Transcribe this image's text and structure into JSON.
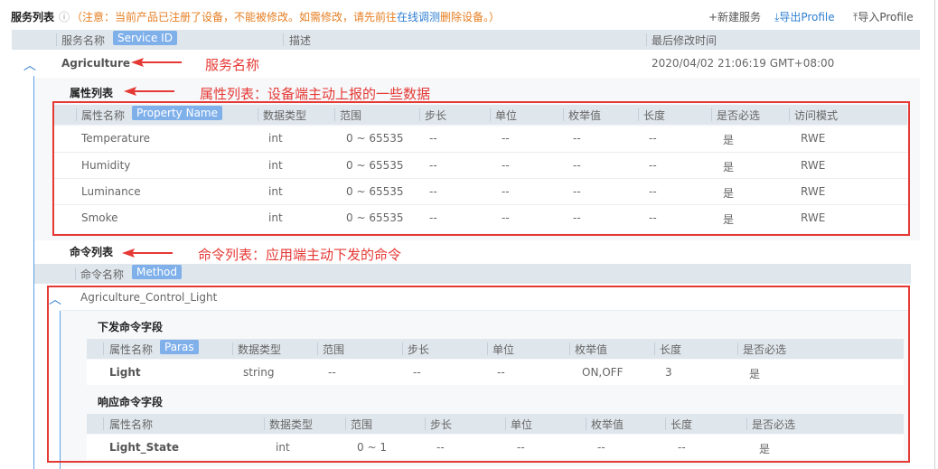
{
  "header": {
    "title": "服务列表",
    "note": "（注意：当前产品已注册了设备，不能被修改。如需修改，请先前往",
    "note_link": "在线调测",
    "note_tail": "删除设备。）",
    "new_service": "+新建服务",
    "export_profile": "导出Profile",
    "import_profile": "导入Profile"
  },
  "service_table": {
    "col_name": "服务名称",
    "col_badge": "Service ID",
    "col_desc": "描述",
    "col_modified": "最后修改时间"
  },
  "service": {
    "name": "Agriculture",
    "modified": "2020/04/02 21:06:19 GMT+08:00",
    "annotation": "服务名称"
  },
  "properties": {
    "section_title": "属性列表",
    "annotation": "属性列表：设备端主动上报的一些数据",
    "headers": [
      "属性名称",
      "数据类型",
      "范围",
      "步长",
      "单位",
      "枚举值",
      "长度",
      "是否必选",
      "访问模式"
    ],
    "name_badge": "Property Name",
    "rows": [
      [
        "Temperature",
        "int",
        "0 ~ 65535",
        "--",
        "--",
        "--",
        "--",
        "是",
        "RWE"
      ],
      [
        "Humidity",
        "int",
        "0 ~ 65535",
        "--",
        "--",
        "--",
        "--",
        "是",
        "RWE"
      ],
      [
        "Luminance",
        "int",
        "0 ~ 65535",
        "--",
        "--",
        "--",
        "--",
        "是",
        "RWE"
      ],
      [
        "Smoke",
        "int",
        "0 ~ 65535",
        "--",
        "--",
        "--",
        "--",
        "是",
        "RWE"
      ]
    ]
  },
  "commands": {
    "section_title": "命令列表",
    "annotation": "命令列表：应用端主动下发的命令",
    "col_name": "命令名称",
    "col_badge": "Method",
    "command_name": "Agriculture_Control_Light",
    "request": {
      "title": "下发命令字段",
      "headers": [
        "属性名称",
        "数据类型",
        "范围",
        "步长",
        "单位",
        "枚举值",
        "长度",
        "是否必选"
      ],
      "name_badge": "Paras",
      "row": [
        "Light",
        "string",
        "--",
        "--",
        "--",
        "ON,OFF",
        "3",
        "是"
      ]
    },
    "response": {
      "title": "响应命令字段",
      "headers": [
        "属性名称",
        "数据类型",
        "范围",
        "步长",
        "单位",
        "枚举值",
        "长度",
        "是否必选"
      ],
      "row": [
        "Light_State",
        "int",
        "0 ~ 1",
        "--",
        "--",
        "--",
        "--",
        "是"
      ]
    }
  },
  "colors": {
    "annotation": "#e53935",
    "accent": "#2f7fd0",
    "badge": "#7fb0ea",
    "header_bg": "#dfe6ec"
  }
}
